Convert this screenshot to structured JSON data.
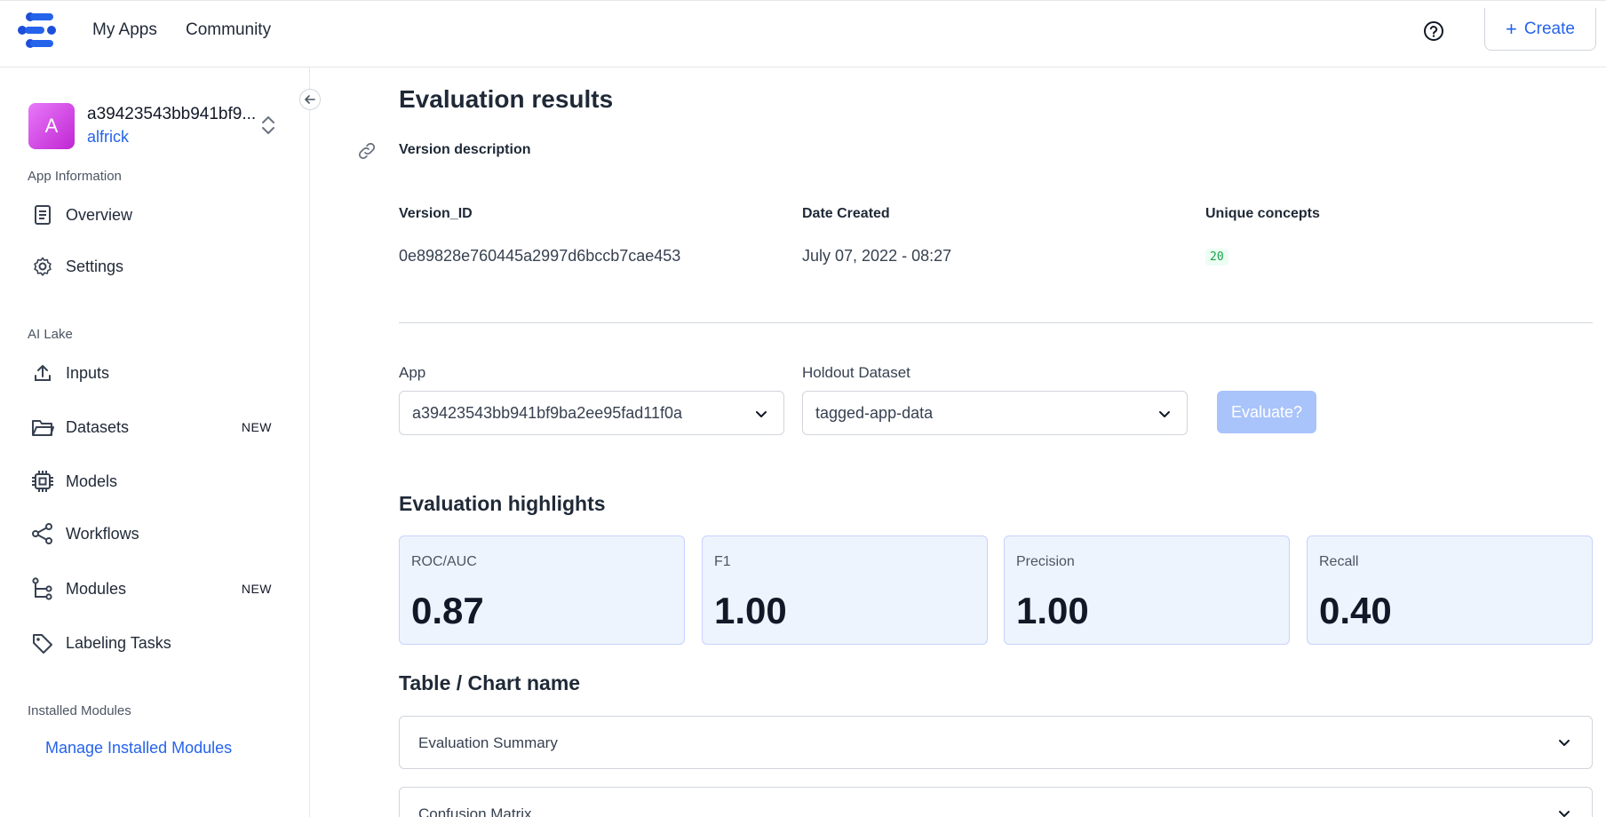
{
  "topbar": {
    "logo_icon": "clarifai-logo-icon",
    "nav": [
      "My Apps",
      "Community"
    ],
    "help_icon": "help-circle-icon",
    "create_label": "Create"
  },
  "sidebar": {
    "avatar_letter": "A",
    "app_name": "a39423543bb941bf9...",
    "app_user": "alfrick",
    "sections": {
      "app_information": "App Information",
      "ai_lake": "AI Lake",
      "installed_modules": "Installed Modules"
    },
    "items": [
      {
        "label": "Overview",
        "icon": "document-icon",
        "badge": ""
      },
      {
        "label": "Settings",
        "icon": "gear-icon",
        "badge": ""
      },
      {
        "label": "Inputs",
        "icon": "upload-icon",
        "badge": ""
      },
      {
        "label": "Datasets",
        "icon": "folder-icon",
        "badge": "NEW"
      },
      {
        "label": "Models",
        "icon": "chip-icon",
        "badge": ""
      },
      {
        "label": "Workflows",
        "icon": "share-icon",
        "badge": ""
      },
      {
        "label": "Modules",
        "icon": "modules-icon",
        "badge": "NEW"
      },
      {
        "label": "Labeling Tasks",
        "icon": "tag-icon",
        "badge": ""
      }
    ],
    "manage_link": "Manage Installed Modules"
  },
  "main": {
    "title": "Evaluation results",
    "version_description": "Version description",
    "meta": {
      "version_id_label": "Version_ID",
      "version_id_value": "0e89828e760445a2997d6bccb7cae453",
      "date_label": "Date Created",
      "date_value": "July 07, 2022 - 08:27",
      "concepts_label": "Unique concepts",
      "concepts_value": "20"
    },
    "form": {
      "app_label": "App",
      "app_value": "a39423543bb941bf9ba2ee95fad11f0a",
      "dataset_label": "Holdout Dataset",
      "dataset_value": "tagged-app-data",
      "evaluate_label": "Evaluate?"
    },
    "highlights_title": "Evaluation highlights",
    "metrics": [
      {
        "label": "ROC/AUC",
        "value": "0.87"
      },
      {
        "label": "F1",
        "value": "1.00"
      },
      {
        "label": "Precision",
        "value": "1.00"
      },
      {
        "label": "Recall",
        "value": "0.40"
      }
    ],
    "table_title": "Table / Chart name",
    "accordions": [
      {
        "label": "Evaluation Summary"
      },
      {
        "label": "Confusion Matrix"
      }
    ]
  },
  "colors": {
    "accent": "#2563eb",
    "avatar": "#d946ef",
    "metric_card_bg": "#eef4fd",
    "evaluate_disabled": "#a9c3fb"
  }
}
